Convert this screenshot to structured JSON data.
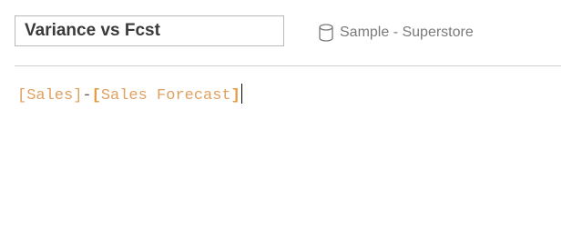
{
  "calc": {
    "name": "Variance vs Fcst",
    "datasource_icon": "database-icon",
    "datasource_label": "Sample - Superstore",
    "formula": {
      "token1": "[Sales]",
      "operator": "-",
      "token2_open": "[",
      "token2_text": "Sales Forecast",
      "token2_close": "]"
    }
  },
  "colors": {
    "field": "#e0a060",
    "field_highlight": "#e49a3e",
    "operator": "#555555",
    "muted_text": "#7a7a7a"
  }
}
